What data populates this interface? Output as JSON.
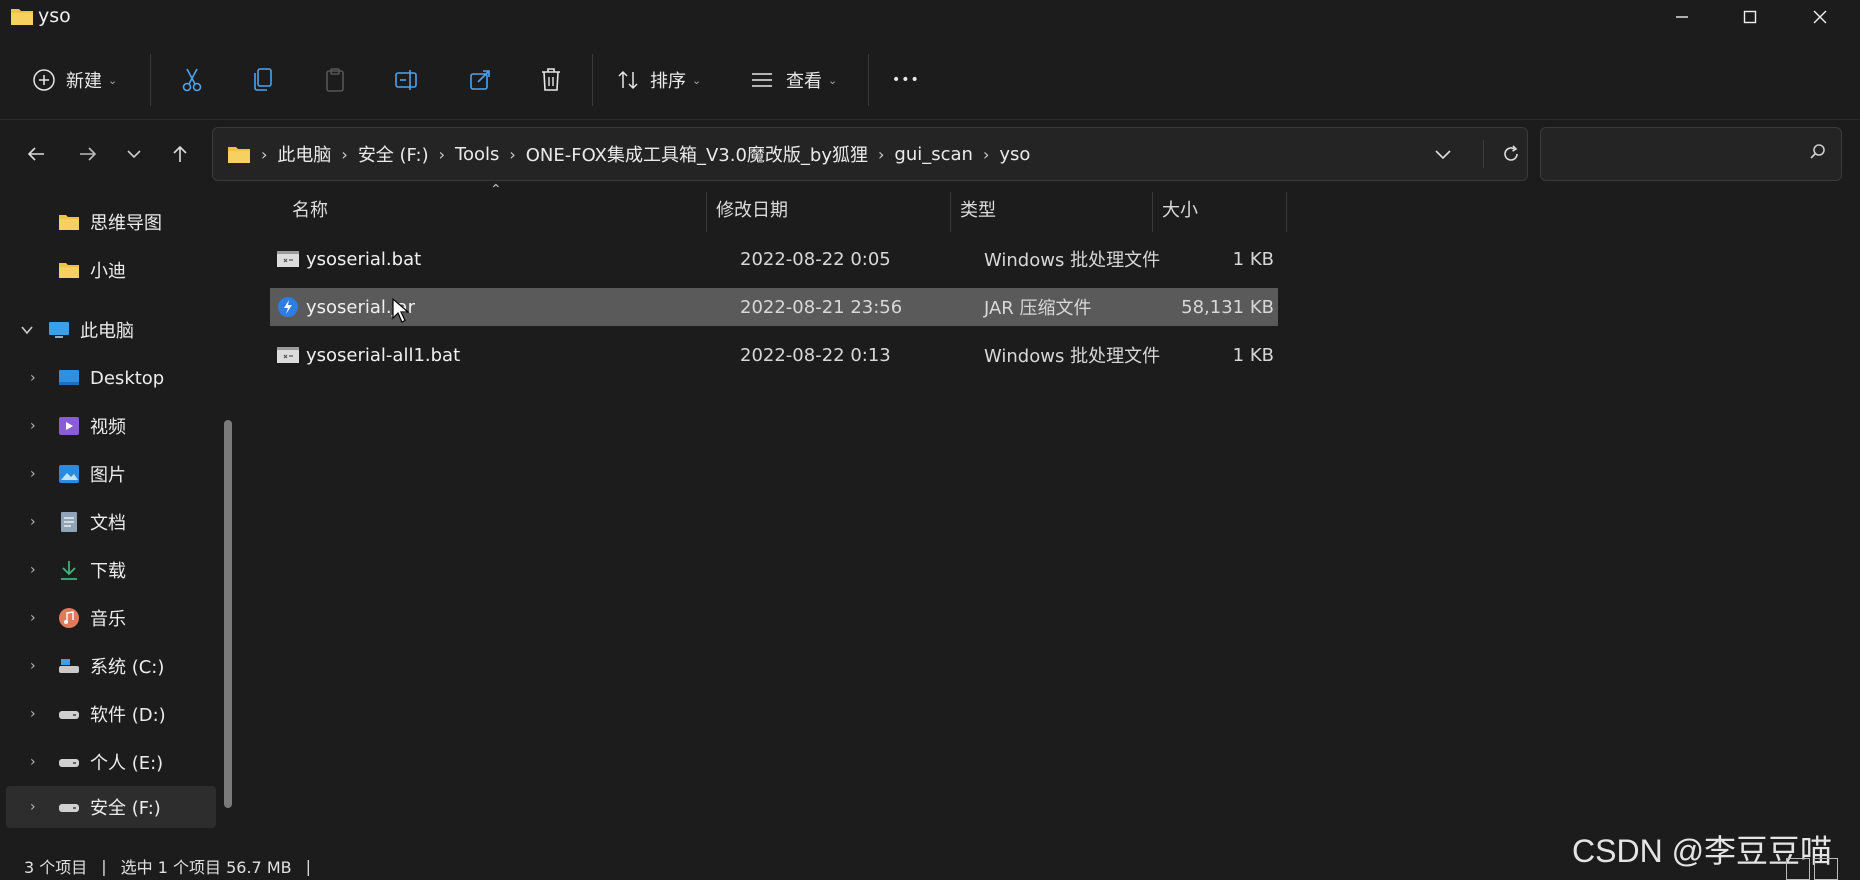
{
  "window": {
    "title": "yso",
    "minimize_glyph": "—",
    "maximize_glyph": "☐",
    "close_glyph": "✕"
  },
  "toolbar": {
    "new_label": "新建",
    "sort_label": "排序",
    "view_label": "查看",
    "more_glyph": "•••",
    "caret": "⌄"
  },
  "address": {
    "crumbs": [
      "此电脑",
      "安全 (F:)",
      "Tools",
      "ONE-FOX集成工具箱_V3.0魔改版_by狐狸",
      "gui_scan",
      "yso"
    ],
    "separator": "›",
    "search_placeholder": ""
  },
  "sidebar": {
    "items": [
      {
        "label": "思维导图",
        "icon": "folder-icon",
        "expandable": false
      },
      {
        "label": "小迪",
        "icon": "folder-icon",
        "expandable": false
      },
      {
        "label": "此电脑",
        "icon": "computer-icon",
        "expandable": true,
        "expanded": true
      },
      {
        "label": "Desktop",
        "icon": "desktop-icon",
        "expandable": true
      },
      {
        "label": "视频",
        "icon": "video-icon",
        "expandable": true
      },
      {
        "label": "图片",
        "icon": "picture-icon",
        "expandable": true
      },
      {
        "label": "文档",
        "icon": "document-icon",
        "expandable": true
      },
      {
        "label": "下载",
        "icon": "download-icon",
        "expandable": true
      },
      {
        "label": "音乐",
        "icon": "music-icon",
        "expandable": true
      },
      {
        "label": "系统 (C:)",
        "icon": "drive-icon",
        "expandable": true
      },
      {
        "label": "软件 (D:)",
        "icon": "drive-icon",
        "expandable": true
      },
      {
        "label": "个人 (E:)",
        "icon": "drive-icon",
        "expandable": true
      },
      {
        "label": "安全 (F:)",
        "icon": "drive-icon",
        "expandable": true,
        "selected": true
      }
    ]
  },
  "columns": {
    "name": "名称",
    "modified": "修改日期",
    "type": "类型",
    "size": "大小"
  },
  "files": [
    {
      "name": "ysoserial.bat",
      "modified": "2022-08-22 0:05",
      "type": "Windows 批处理文件",
      "size": "1 KB",
      "icon": "batch-file-icon",
      "selected": false
    },
    {
      "name": "ysoserial.jar",
      "modified": "2022-08-21 23:56",
      "type": "JAR 压缩文件",
      "size": "58,131 KB",
      "icon": "jar-file-icon",
      "selected": true
    },
    {
      "name": "ysoserial-all1.bat",
      "modified": "2022-08-22 0:13",
      "type": "Windows 批处理文件",
      "size": "1 KB",
      "icon": "batch-file-icon",
      "selected": false
    }
  ],
  "status": {
    "item_count": "3 个项目",
    "selection": "选中 1 个项目  56.7 MB",
    "separator": "|"
  },
  "watermark": "CSDN @李豆豆喵",
  "colors": {
    "background": "#1c1c1c",
    "selected_row": "#5a5a5a",
    "folder": "#f2c244",
    "accent_blue": "#2e7de0"
  }
}
